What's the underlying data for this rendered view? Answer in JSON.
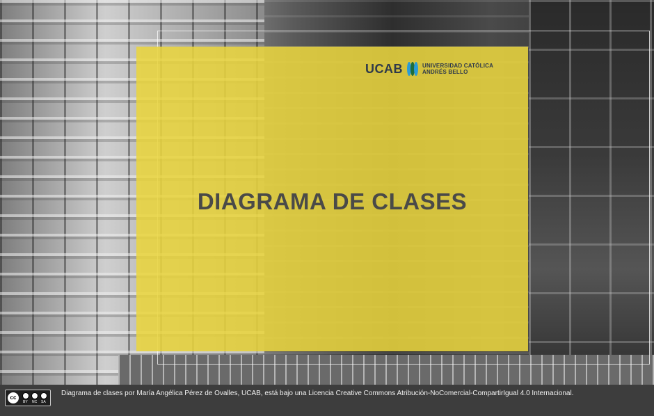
{
  "logo": {
    "abbrev": "UCAB",
    "name_line1": "UNIVERSIDAD CATÓLICA",
    "name_line2": "ANDRÉS BELLO",
    "icon": "ucab-emblem-icon"
  },
  "title": "DIAGRAMA DE CLASES",
  "license": {
    "badge_icon": "creative-commons-by-nc-sa-icon",
    "badge_labels": [
      "BY",
      "NC",
      "SA"
    ],
    "badge_cc": "cc",
    "text": "Diagrama de clases por María Angélica Pérez de Ovalles, UCAB, está bajo una Licencia Creative Commons Atribución-NoComercial-CompartirIgual 4.0 Internacional."
  },
  "colors": {
    "overlay_yellow": "#E9D53F",
    "title_gray": "#4A4A48",
    "footer_bg": "#3D3D3D",
    "logo_navy": "#2F3A4A"
  }
}
